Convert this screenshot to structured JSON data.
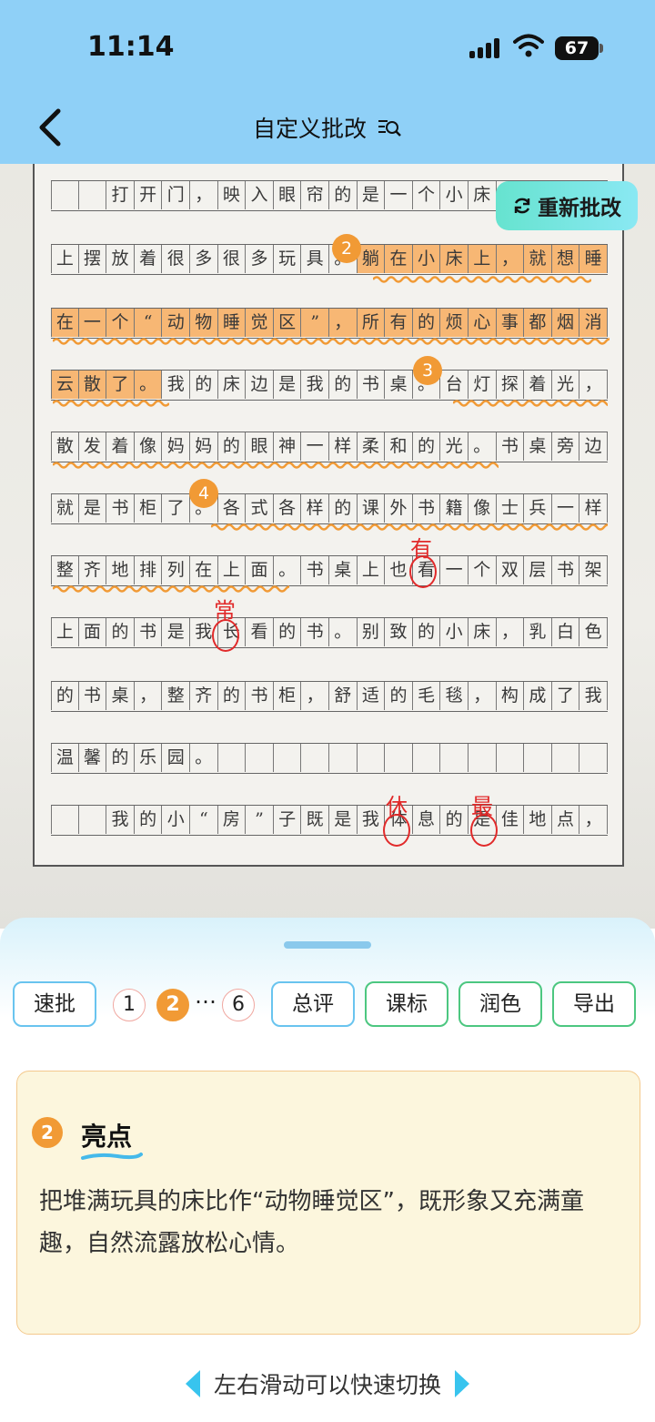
{
  "status": {
    "time": "11:14",
    "battery": "67"
  },
  "header": {
    "title": "自定义批改"
  },
  "photo": {
    "retry_label": "重新批改",
    "rows": [
      {
        "cells": [
          "",
          "",
          "打",
          "开",
          "门",
          "，",
          "映",
          "入",
          "眼",
          "帘",
          "的",
          "是",
          "一",
          "个",
          "小",
          "床",
          "，",
          "",
          "",
          ""
        ],
        "hl": []
      },
      {
        "cells": [
          "上",
          "摆",
          "放",
          "着",
          "很",
          "多",
          "很",
          "多",
          "玩",
          "具",
          "。",
          "躺",
          "在",
          "小",
          "床",
          "上",
          "，",
          "就",
          "想",
          "睡"
        ],
        "hl": [
          11,
          12,
          13,
          14,
          15,
          16,
          17,
          18,
          19
        ]
      },
      {
        "cells": [
          "在",
          "一",
          "个",
          "“",
          "动",
          "物",
          "睡",
          "觉",
          "区",
          "”",
          "，",
          "所",
          "有",
          "的",
          "烦",
          "心",
          "事",
          "都",
          "烟",
          "消"
        ],
        "hl": [
          0,
          1,
          2,
          3,
          4,
          5,
          6,
          7,
          8,
          9,
          10,
          11,
          12,
          13,
          14,
          15,
          16,
          17,
          18,
          19
        ]
      },
      {
        "cells": [
          "云",
          "散",
          "了",
          "。",
          "我",
          "的",
          "床",
          "边",
          "是",
          "我",
          "的",
          "书",
          "桌",
          "。",
          "台",
          "灯",
          "探",
          "着",
          "光",
          "，"
        ],
        "hl": [
          0,
          1,
          2,
          3
        ]
      },
      {
        "cells": [
          "散",
          "发",
          "着",
          "像",
          "妈",
          "妈",
          "的",
          "眼",
          "神",
          "一",
          "样",
          "柔",
          "和",
          "的",
          "光",
          "。",
          "书",
          "桌",
          "旁",
          "边"
        ],
        "hl": []
      },
      {
        "cells": [
          "就",
          "是",
          "书",
          "柜",
          "了",
          "。",
          "各",
          "式",
          "各",
          "样",
          "的",
          "课",
          "外",
          "书",
          "籍",
          "像",
          "士",
          "兵",
          "一",
          "样"
        ],
        "hl": []
      },
      {
        "cells": [
          "整",
          "齐",
          "地",
          "排",
          "列",
          "在",
          "上",
          "面",
          "。",
          "书",
          "桌",
          "上",
          "也",
          "看",
          "一",
          "个",
          "双",
          "层",
          "书",
          "架"
        ],
        "hl": []
      },
      {
        "cells": [
          "上",
          "面",
          "的",
          "书",
          "是",
          "我",
          "长",
          "看",
          "的",
          "书",
          "。",
          "别",
          "致",
          "的",
          "小",
          "床",
          "，",
          "乳",
          "白",
          "色"
        ],
        "hl": []
      },
      {
        "cells": [
          "的",
          "书",
          "桌",
          "，",
          "整",
          "齐",
          "的",
          "书",
          "柜",
          "，",
          "舒",
          "适",
          "的",
          "毛",
          "毯",
          "，",
          "构",
          "成",
          "了",
          "我"
        ],
        "hl": []
      },
      {
        "cells": [
          "温",
          "馨",
          "的",
          "乐",
          "园",
          "。",
          "",
          "",
          "",
          "",
          "",
          "",
          "",
          "",
          "",
          "",
          "",
          "",
          "",
          ""
        ],
        "hl": []
      },
      {
        "cells": [
          "",
          "",
          "我",
          "的",
          "小",
          "“",
          "房",
          "”",
          "子",
          "既",
          "是",
          "我",
          "体",
          "息",
          "的",
          "是",
          "佳",
          "地",
          "点",
          "，"
        ],
        "hl": []
      }
    ],
    "badges": [
      "2",
      "3",
      "4"
    ],
    "corrections": [
      "有",
      "常",
      "休",
      "最"
    ]
  },
  "toolbar": {
    "quick": "速批",
    "pages": [
      "1",
      "2",
      "…",
      "6"
    ],
    "summary": "总评",
    "standard": "课标",
    "polish": "润色",
    "export": "导出"
  },
  "card": {
    "badge": "2",
    "title": "亮点",
    "text": "把堆满玩具的床比作“动物睡觉区”，既形象又充满童趣，自然流露放松心情。"
  },
  "hint": "左右滑动可以快速切换",
  "colors": {
    "header": "#8fd0f7",
    "accent": "#f19a35",
    "highlight": "#f7a652",
    "correction": "#e12a2a"
  }
}
